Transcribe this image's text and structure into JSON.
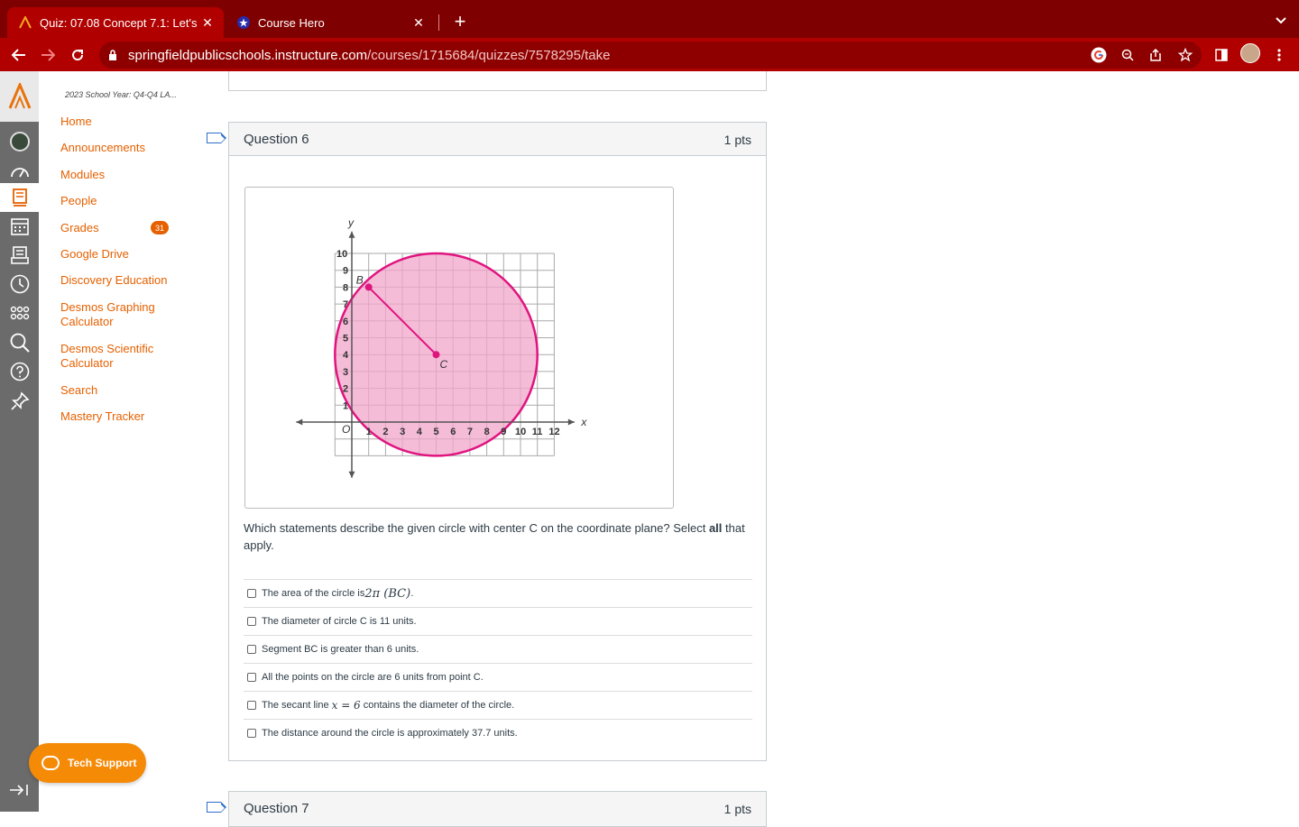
{
  "browser": {
    "tabs": [
      {
        "title": "Quiz: 07.08 Concept 7.1: Let's",
        "active": true,
        "favicon": "canvas-icon"
      },
      {
        "title": "Course Hero",
        "active": false,
        "favicon": "star-icon"
      }
    ],
    "url_host": "springfieldpublicschools.instructure.com",
    "url_path": "/courses/1715684/quizzes/7578295/take"
  },
  "course_nav": {
    "school_year": "2023 School Year: Q4-Q4 LA...",
    "items": [
      {
        "label": "Home"
      },
      {
        "label": "Announcements"
      },
      {
        "label": "Modules"
      },
      {
        "label": "People"
      },
      {
        "label": "Grades",
        "badge": "31"
      },
      {
        "label": "Google Drive"
      },
      {
        "label": "Discovery Education"
      },
      {
        "label": "Desmos Graphing Calculator"
      },
      {
        "label": "Desmos Scientific Calculator"
      },
      {
        "label": "Search"
      },
      {
        "label": "Mastery Tracker"
      }
    ],
    "tech_support": "Tech Support"
  },
  "question6": {
    "title": "Question 6",
    "points": "1 pts",
    "prompt_before": "Which statements describe the given circle with center C on the coordinate plane? Select ",
    "prompt_bold": "all",
    "prompt_after": " that apply.",
    "answers": [
      {
        "pre": "The area of the circle is ",
        "math": "2π (BC)",
        "post": "."
      },
      {
        "pre": "The diameter of circle C is 11 units.",
        "math": "",
        "post": ""
      },
      {
        "pre": "Segment BC is greater than 6 units.",
        "math": "",
        "post": ""
      },
      {
        "pre": "All the points on the circle are 6 units from point C.",
        "math": "",
        "post": ""
      },
      {
        "pre": "The secant line ",
        "math": "x = 6",
        "post": " contains the diameter of the circle."
      },
      {
        "pre": "The distance around the circle is approximately 37.7 units.",
        "math": "",
        "post": ""
      }
    ]
  },
  "question7": {
    "title": "Question 7",
    "points": "1 pts"
  },
  "graph": {
    "x_axis_label": "x",
    "y_axis_label": "y",
    "origin_label": "O",
    "x_ticks": [
      "1",
      "2",
      "3",
      "4",
      "5",
      "6",
      "7",
      "8",
      "9",
      "10",
      "11",
      "12"
    ],
    "y_ticks": [
      "1",
      "2",
      "3",
      "4",
      "5",
      "6",
      "7",
      "8",
      "9",
      "10"
    ],
    "center": {
      "label": "C",
      "x": 5,
      "y": 4
    },
    "point_b": {
      "label": "B",
      "x": 1,
      "y": 8
    },
    "radius": 6,
    "circle_color": "#e0147f",
    "fill_color": "#f2a6cb"
  }
}
